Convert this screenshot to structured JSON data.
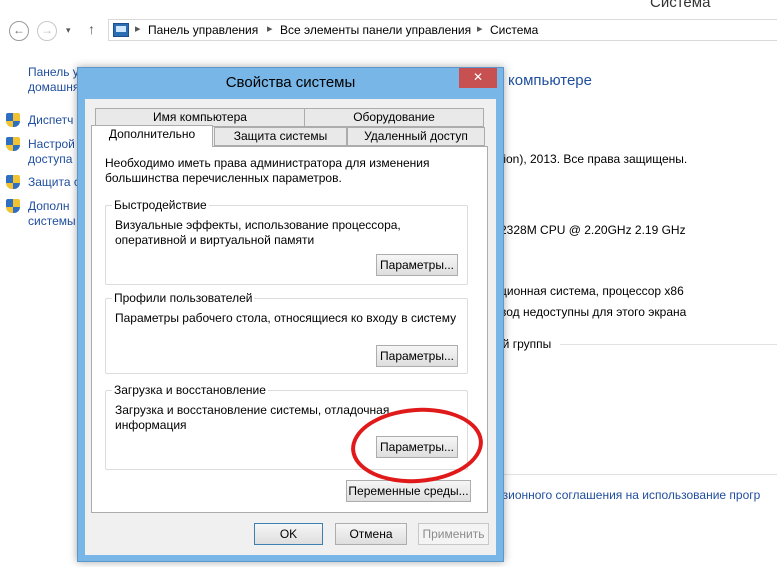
{
  "window": {
    "title": "Система"
  },
  "navbar": {
    "back": "←",
    "forward": "→",
    "dropdown": "▾",
    "up": "↑",
    "breadcrumb": [
      "Панель управления",
      "Все элементы панели управления",
      "Система"
    ],
    "separator": "▸"
  },
  "left_panel": {
    "home_link_line1": "Панель у",
    "home_link_line2": "домашня",
    "items": [
      {
        "line1": "Диспетч",
        "line2": ""
      },
      {
        "line1": "Настрой",
        "line2": "доступа"
      },
      {
        "line1": "Защита с",
        "line2": ""
      },
      {
        "line1": "Дополн",
        "line2": "системы"
      }
    ]
  },
  "background_content": {
    "heading": "компьютере",
    "copyright": "tion), 2013. Все права защищены.",
    "cpu": "2328M CPU @ 2.20GHz   2.19 GHz",
    "os_type": "ционная система, процессор x86",
    "pen_input": "вод недоступны для этого экрана",
    "workgroup": "ей группы",
    "license_link": "нзионного соглашения на использование прогр"
  },
  "dialog": {
    "title": "Свойства системы",
    "close": "✕",
    "tabs_row1": [
      "Имя компьютера",
      "Оборудование"
    ],
    "tabs_row2": [
      "Дополнительно",
      "Защита системы",
      "Удаленный доступ"
    ],
    "intro": "Необходимо иметь права администратора для изменения большинства перечисленных параметров.",
    "groups": {
      "performance": {
        "title": "Быстродействие",
        "desc": "Визуальные эффекты, использование процессора, оперативной и виртуальной памяти",
        "button": "Параметры..."
      },
      "profiles": {
        "title": "Профили пользователей",
        "desc": "Параметры рабочего стола, относящиеся ко входу в систему",
        "button": "Параметры..."
      },
      "startup": {
        "title": "Загрузка и восстановление",
        "desc": "Загрузка и восстановление системы, отладочная информация",
        "button": "Параметры..."
      }
    },
    "env_button": "Переменные среды...",
    "ok": "OK",
    "cancel": "Отмена",
    "apply": "Применить"
  },
  "colors": {
    "dialog_frame": "#77b6e7",
    "close_button": "#c75050",
    "link": "#1f4e9e",
    "highlight_circle": "#e01a1a"
  }
}
